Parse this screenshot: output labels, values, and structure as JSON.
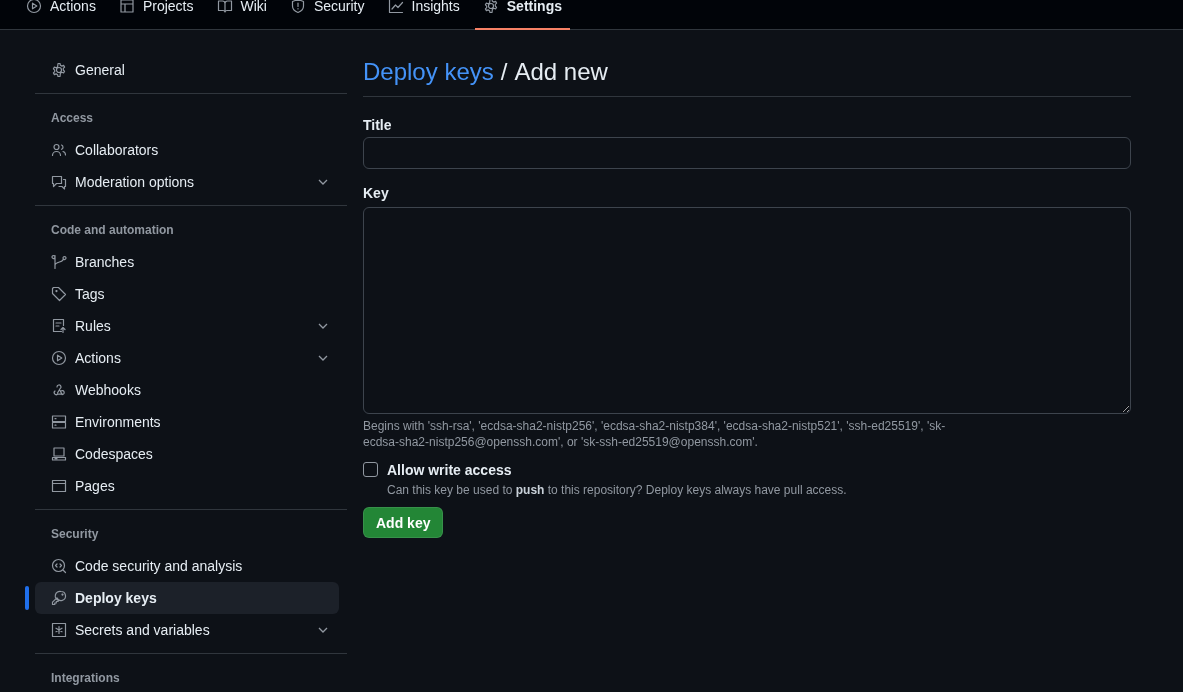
{
  "nav_tabs": [
    {
      "label": "Actions",
      "selected": false
    },
    {
      "label": "Projects",
      "selected": false
    },
    {
      "label": "Wiki",
      "selected": false
    },
    {
      "label": "Security",
      "selected": false
    },
    {
      "label": "Insights",
      "selected": false
    },
    {
      "label": "Settings",
      "selected": true
    }
  ],
  "sidebar": {
    "top_item": {
      "label": "General",
      "selected": false
    },
    "sections": [
      {
        "heading": "Access",
        "items": [
          {
            "label": "Collaborators",
            "selected": false
          },
          {
            "label": "Moderation options",
            "selected": false,
            "expanded": false
          }
        ]
      },
      {
        "heading": "Code and automation",
        "items": [
          {
            "label": "Branches",
            "selected": false
          },
          {
            "label": "Tags",
            "selected": false
          },
          {
            "label": "Rules",
            "selected": false,
            "expanded": false
          },
          {
            "label": "Actions",
            "selected": false,
            "expanded": false
          },
          {
            "label": "Webhooks",
            "selected": false
          },
          {
            "label": "Environments",
            "selected": false
          },
          {
            "label": "Codespaces",
            "selected": false
          },
          {
            "label": "Pages",
            "selected": false
          }
        ]
      },
      {
        "heading": "Security",
        "items": [
          {
            "label": "Code security and analysis",
            "selected": false
          },
          {
            "label": "Deploy keys",
            "selected": true
          },
          {
            "label": "Secrets and variables",
            "selected": false,
            "expanded": false
          }
        ]
      },
      {
        "heading": "Integrations"
      }
    ]
  },
  "main": {
    "breadcrumb_link": "Deploy keys",
    "separator": "/",
    "heading": "Add new",
    "title_label": "Title",
    "key_label": "Key",
    "key_hint": "Begins with 'ssh-rsa', 'ecdsa-sha2-nistp256', 'ecdsa-sha2-nistp384', 'ecdsa-sha2-nistp521', 'ssh-ed25519', 'sk-ecdsa-sha2-nistp256@openssh.com', or 'sk-ssh-ed25519@openssh.com'.",
    "write_access": {
      "label": "Allow write access",
      "checked": false,
      "description": "Can this key be used to **push** to this repository? Deploy keys always have pull access."
    },
    "submit_button": "Add key"
  }
}
